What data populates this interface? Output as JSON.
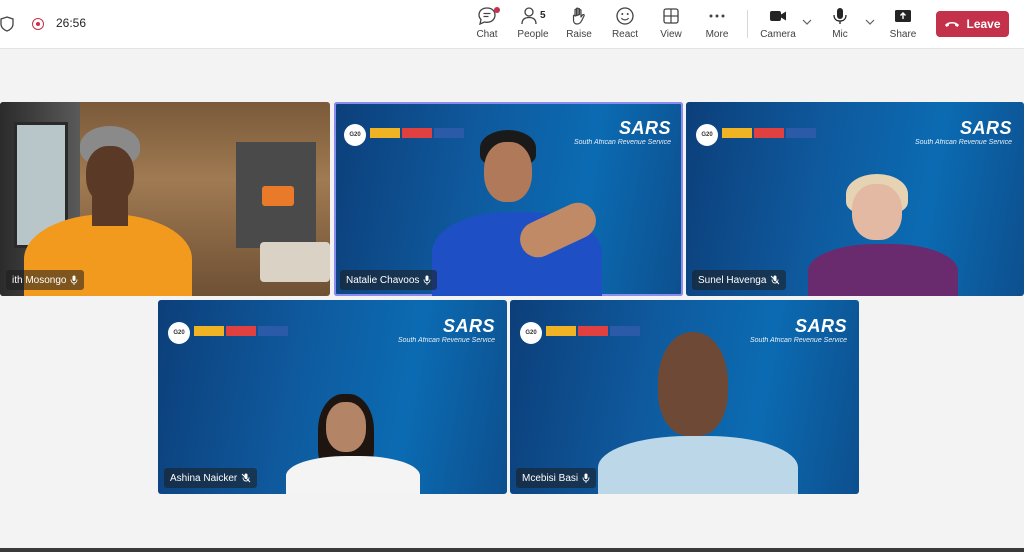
{
  "meeting": {
    "timer": "26:56",
    "recording": true
  },
  "toolbar": {
    "chat_label": "Chat",
    "people_label": "People",
    "people_count": "5",
    "raise_label": "Raise",
    "react_label": "React",
    "view_label": "View",
    "more_label": "More",
    "camera_label": "Camera",
    "mic_label": "Mic",
    "share_label": "Share",
    "leave_label": "Leave"
  },
  "brand": {
    "logo_word": "SARS",
    "logo_sub": "South African Revenue Service",
    "g20": "G20"
  },
  "participants": [
    {
      "name": "ith Mosongo",
      "mic": "on"
    },
    {
      "name": "Natalie Chavoos",
      "mic": "on",
      "speaking": true
    },
    {
      "name": "Sunel Havenga",
      "mic": "muted"
    },
    {
      "name": "Ashina Naicker",
      "mic": "muted"
    },
    {
      "name": "Mcebisi Basi",
      "mic": "on"
    }
  ],
  "colors": {
    "leave": "#c4314b",
    "speaking_outline": "#8b8cf0",
    "sars_blue": "#0f5a9e"
  }
}
